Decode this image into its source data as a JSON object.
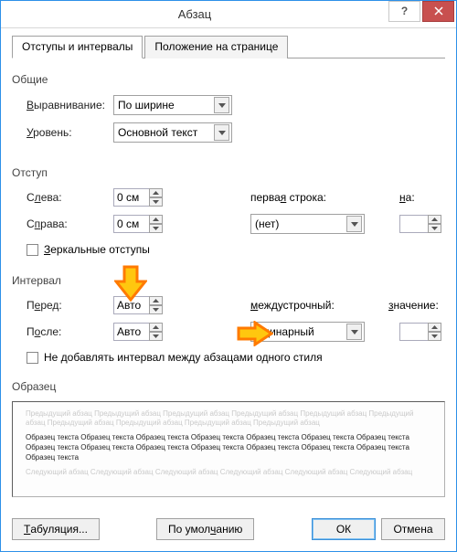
{
  "window": {
    "title": "Абзац"
  },
  "tabs": {
    "active": "Отступы и интервалы",
    "inactive": "Положение на странице"
  },
  "general": {
    "heading": "Общие",
    "alignment_label": "Выравнивание:",
    "alignment_value": "По ширине",
    "level_label": "Уровень:",
    "level_value": "Основной текст"
  },
  "indent": {
    "heading": "Отступ",
    "left_label": "Слева:",
    "left_value": "0 см",
    "right_label": "Справа:",
    "right_value": "0 см",
    "firstline_label": "первая строка:",
    "firstline_value": "(нет)",
    "by_label": "на:",
    "by_value": "",
    "mirror_label": "Зеркальные отступы"
  },
  "spacing": {
    "heading": "Интервал",
    "before_label": "Перед:",
    "before_value": "Авто",
    "after_label": "После:",
    "after_value": "Авто",
    "linespacing_label": "междустрочный:",
    "linespacing_value": "Одинарный",
    "at_label": "значение:",
    "at_value": "",
    "noadd_label": "Не добавлять интервал между абзацами одного стиля"
  },
  "preview": {
    "heading": "Образец",
    "gray1": "Предыдущий абзац Предыдущий абзац Предыдущий абзац Предыдущий абзац Предыдущий абзац Предыдущий абзац Предыдущий абзац Предыдущий абзац Предыдущий абзац Предыдущий абзац",
    "black": "Образец текста Образец текста Образец текста Образец текста Образец текста Образец текста Образец текста Образец текста Образец текста Образец текста Образец текста Образец текста Образец текста Образец текста Образец текста",
    "gray2": "Следующий абзац Следующий абзац Следующий абзац Следующий абзац Следующий абзац Следующий абзац"
  },
  "buttons": {
    "tabs": "Табуляция...",
    "default": "По умолчанию",
    "ok": "ОК",
    "cancel": "Отмена"
  },
  "titlebar": {
    "help": "?"
  }
}
